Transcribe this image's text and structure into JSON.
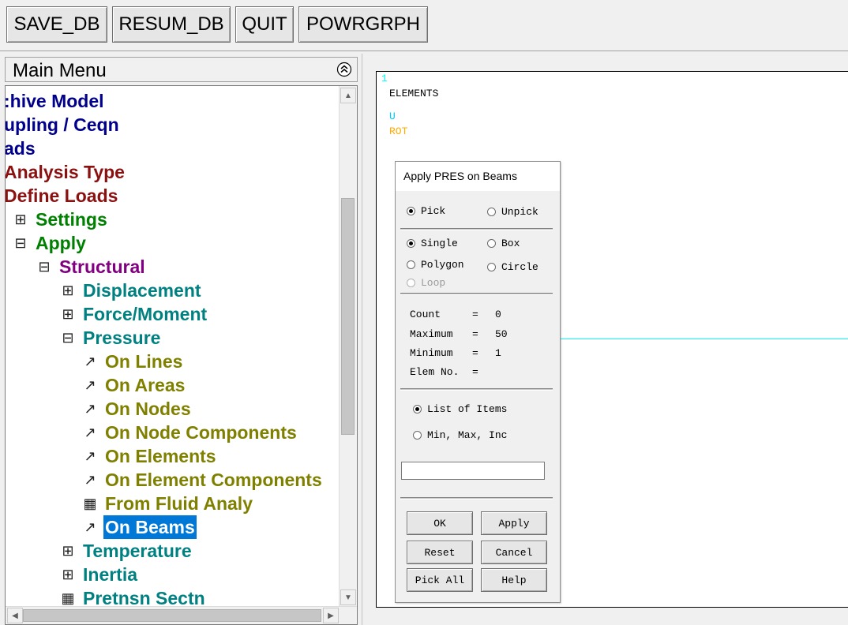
{
  "toolbar": {
    "buttons": [
      "SAVE_DB",
      "RESUM_DB",
      "QUIT",
      "POWRGRPH"
    ]
  },
  "main_menu": {
    "title": "Main Menu",
    "items": [
      {
        "label": ":hive Model",
        "glyph": "",
        "color": "#00008b"
      },
      {
        "label": "upling / Ceqn",
        "glyph": "",
        "color": "#00008b"
      },
      {
        "label": "ads",
        "glyph": "",
        "color": "#00008b"
      },
      {
        "label": "Analysis Type",
        "glyph": "",
        "color": "#8b1010"
      },
      {
        "label": "Define Loads",
        "glyph": "",
        "color": "#8b1010"
      },
      {
        "label": "Settings",
        "glyph": "⊞",
        "color": "#008000"
      },
      {
        "label": "Apply",
        "glyph": "⊟",
        "color": "#008000"
      },
      {
        "label": "Structural",
        "glyph": "⊟",
        "color": "#800080"
      },
      {
        "label": "Displacement",
        "glyph": "⊞",
        "color": "#008080"
      },
      {
        "label": "Force/Moment",
        "glyph": "⊞",
        "color": "#008080"
      },
      {
        "label": "Pressure",
        "glyph": "⊟",
        "color": "#008080"
      },
      {
        "label": "On Lines",
        "glyph": "↗",
        "color": "#808000"
      },
      {
        "label": "On Areas",
        "glyph": "↗",
        "color": "#808000"
      },
      {
        "label": "On Nodes",
        "glyph": "↗",
        "color": "#808000"
      },
      {
        "label": "On Node Components",
        "glyph": "↗",
        "color": "#808000"
      },
      {
        "label": "On Elements",
        "glyph": "↗",
        "color": "#808000"
      },
      {
        "label": "On Element Components",
        "glyph": "↗",
        "color": "#808000"
      },
      {
        "label": "From Fluid Analy",
        "glyph": "▦",
        "color": "#808000"
      },
      {
        "label": "On Beams",
        "glyph": "↗",
        "color": "#808000",
        "selected": true
      },
      {
        "label": "Temperature",
        "glyph": "⊞",
        "color": "#008080"
      },
      {
        "label": "Inertia",
        "glyph": "⊞",
        "color": "#008080"
      },
      {
        "label": "Pretnsn Sectn",
        "glyph": "▦",
        "color": "#008080"
      }
    ]
  },
  "graphics": {
    "window_number": "1",
    "title": "ELEMENTS",
    "legend": [
      "U",
      "ROT"
    ],
    "legend_colors": [
      "#00c8ff",
      "#ffaa00"
    ]
  },
  "pick_dialog": {
    "title": "Apply PRES on Beams",
    "pick_mode": {
      "pick": "Pick",
      "unpick": "Unpick",
      "selected": "Pick"
    },
    "selection_type": {
      "single": "Single",
      "box": "Box",
      "polygon": "Polygon",
      "circle": "Circle",
      "loop": "Loop",
      "selected": "Single"
    },
    "info": {
      "count_label": "Count",
      "count": "0",
      "maximum_label": "Maximum",
      "maximum": "50",
      "minimum_label": "Minimum",
      "minimum": "1",
      "elem_no_label": "Elem No."
    },
    "entry_mode": {
      "list": "List of Items",
      "range": "Min, Max, Inc",
      "selected": "List of Items"
    },
    "input_value": "",
    "buttons": {
      "ok": "OK",
      "apply": "Apply",
      "reset": "Reset",
      "cancel": "Cancel",
      "pick_all": "Pick All",
      "help": "Help"
    }
  }
}
